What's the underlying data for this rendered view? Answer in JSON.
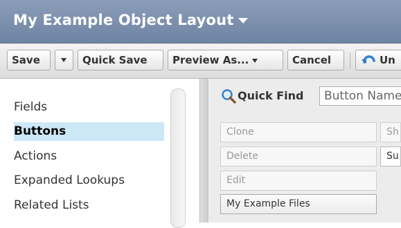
{
  "header": {
    "title": "My Example Object Layout"
  },
  "toolbar": {
    "save": "Save",
    "quick_save": "Quick Save",
    "preview_as": "Preview As...",
    "cancel": "Cancel",
    "undo": "Un"
  },
  "palette": {
    "categories": [
      {
        "label": "Fields",
        "selected": false
      },
      {
        "label": "Buttons",
        "selected": true
      },
      {
        "label": "Actions",
        "selected": false
      },
      {
        "label": "Expanded Lookups",
        "selected": false
      },
      {
        "label": "Related Lists",
        "selected": false
      }
    ],
    "quick_find": {
      "label": "Quick Find",
      "placeholder": "Button Name"
    },
    "buttons": [
      {
        "label": "Clone",
        "in_use": true
      },
      {
        "label": "Delete",
        "in_use": true
      },
      {
        "label": "Edit",
        "in_use": true
      },
      {
        "label": "My Example Files",
        "in_use": false
      },
      {
        "label": "Sh",
        "in_use": true
      },
      {
        "label": "Su",
        "in_use": false
      }
    ]
  },
  "colors": {
    "header_bg": "#7b8fad",
    "selected_bg": "#cce8f7",
    "undo_icon": "#2f7fd1"
  }
}
